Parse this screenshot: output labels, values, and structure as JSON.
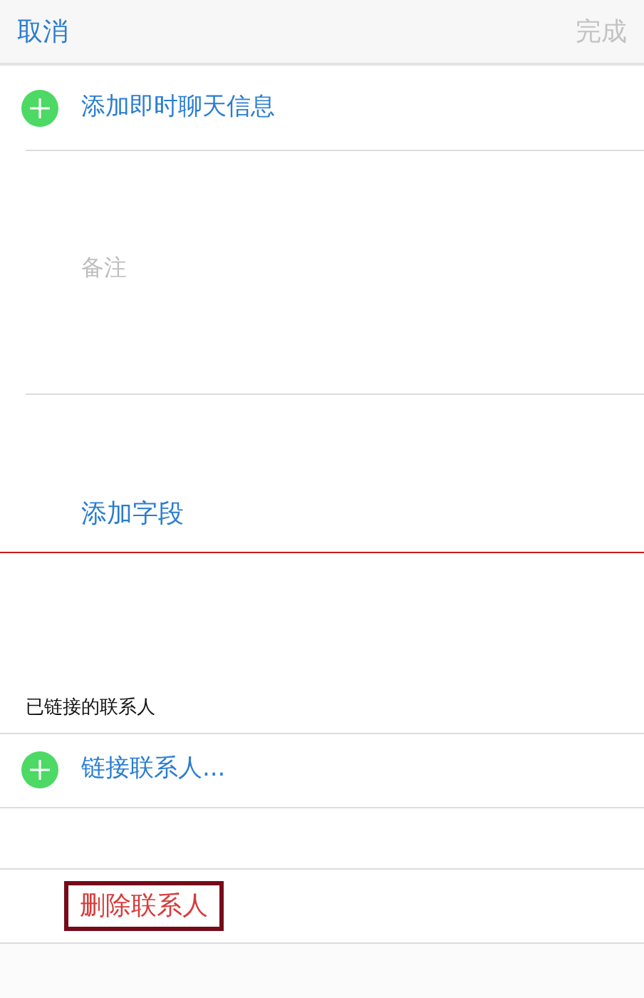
{
  "nav": {
    "cancel": "取消",
    "done": {
      "label": "完成",
      "disabled": true
    }
  },
  "add_im": {
    "label": "添加即时聊天信息"
  },
  "notes": {
    "placeholder": "备注"
  },
  "add_field": {
    "label": "添加字段",
    "marked": true
  },
  "linked": {
    "header": "已链接的联系人",
    "link": {
      "label": "链接联系人..."
    }
  },
  "delete_contact": {
    "label": "删除联系人",
    "highlighted": true
  }
}
